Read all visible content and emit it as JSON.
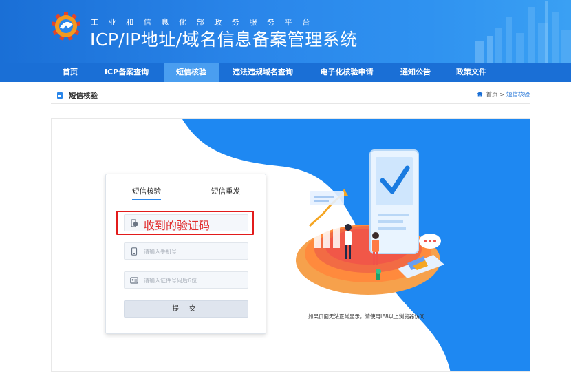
{
  "header": {
    "subtitle": "工业和信息化部政务服务平台",
    "title": "ICP/IP地址/域名信息备案管理系统",
    "colors": {
      "banner": "#1a6fd6",
      "accent": "#2a86ea",
      "logo_orange": "#f39a1f",
      "logo_red": "#d9352b"
    }
  },
  "nav": {
    "items": [
      {
        "label": "首页",
        "active": false
      },
      {
        "label": "ICP备案查询",
        "active": false
      },
      {
        "label": "短信核验",
        "active": true
      },
      {
        "label": "违法违规域名查询",
        "active": false
      },
      {
        "label": "电子化核验申请",
        "active": false
      },
      {
        "label": "通知公告",
        "active": false
      },
      {
        "label": "政策文件",
        "active": false
      }
    ]
  },
  "page": {
    "section_title": "短信核验",
    "breadcrumb": {
      "home": "首页",
      "separator": ">",
      "current": "短信核验"
    }
  },
  "form": {
    "tabs": [
      {
        "label": "短信核验",
        "active": true
      },
      {
        "label": "短信重发",
        "active": false
      }
    ],
    "code_field": {
      "value": "收到的验证码",
      "icon": "sms-icon"
    },
    "phone_field": {
      "placeholder": "请输入手机号",
      "icon": "mobile-icon"
    },
    "id_field": {
      "placeholder": "请输入证件号码后6位",
      "icon": "id-card-icon"
    },
    "submit_label": "提 交"
  },
  "notice": "如果页面无法正常显示，请使用IE8以上浏览器访问"
}
